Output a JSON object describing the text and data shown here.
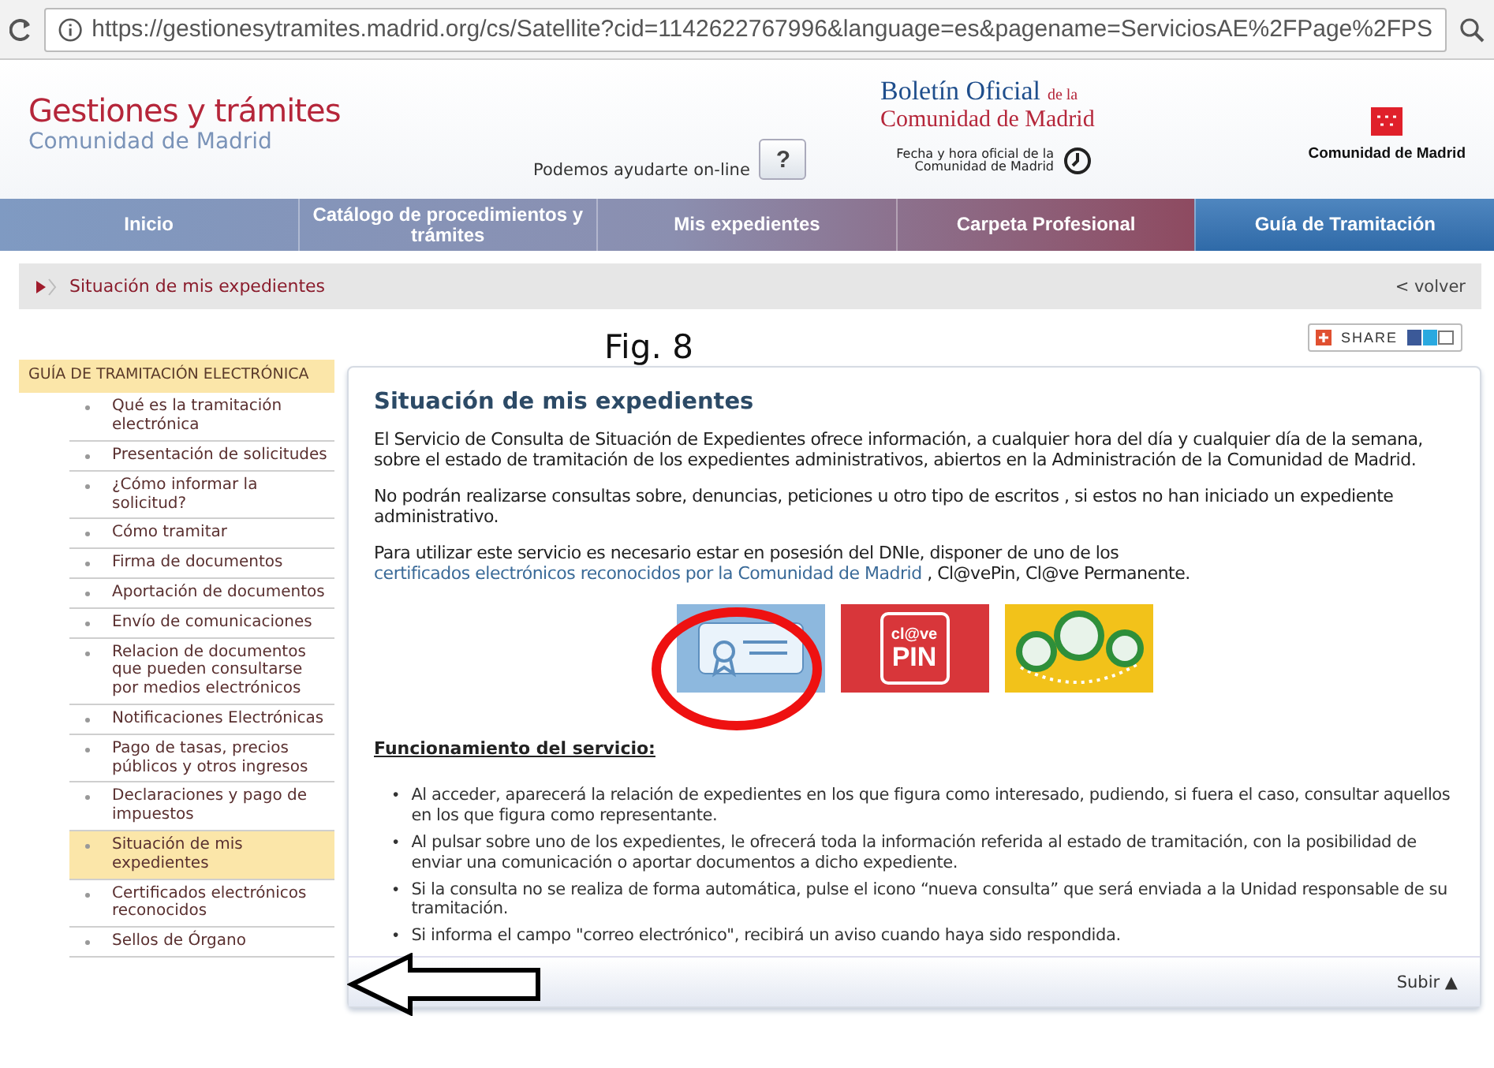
{
  "browser": {
    "url": "https://gestionesytramites.madrid.org/cs/Satellite?cid=1142622767996&language=es&pagename=ServiciosAE%2FPage%2FPS"
  },
  "header": {
    "site_title": "Gestiones y trámites",
    "site_subtitle": "Comunidad de Madrid",
    "help_text": "Podemos ayudarte on-line",
    "help_button": "?",
    "bulletin_title": "Boletín Oficial",
    "bulletin_de_la": "de la",
    "bulletin_subtitle": "Comunidad de Madrid",
    "official_time": "Fecha y hora oficial de la Comunidad de Madrid",
    "region_logo": "Comunidad de Madrid"
  },
  "nav": [
    {
      "label": "Inicio",
      "selected": false
    },
    {
      "label": "Catálogo de procedimientos y trámites",
      "selected": false
    },
    {
      "label": "Mis expedientes",
      "selected": false
    },
    {
      "label": "Carpeta Profesional",
      "selected": false
    },
    {
      "label": "Guía de Tramitación",
      "selected": true
    }
  ],
  "breadcrumb": {
    "current": "Situación de mis expedientes",
    "back": "< volver"
  },
  "share": {
    "label": "SHARE"
  },
  "sidebar": {
    "title": "GUÍA DE TRAMITACIÓN ELECTRÓNICA",
    "items": [
      {
        "label": "Qué es la tramitación electrónica",
        "selected": false
      },
      {
        "label": "Presentación de solicitudes",
        "selected": false
      },
      {
        "label": "¿Cómo informar la solicitud?",
        "selected": false
      },
      {
        "label": "Cómo tramitar",
        "selected": false
      },
      {
        "label": "Firma de documentos",
        "selected": false
      },
      {
        "label": "Aportación de documentos",
        "selected": false
      },
      {
        "label": "Envío de comunicaciones",
        "selected": false
      },
      {
        "label": "Relacion de documentos que pueden consultarse por medios electrónicos",
        "selected": false
      },
      {
        "label": "Notificaciones Electrónicas",
        "selected": false
      },
      {
        "label": "Pago de tasas, precios públicos y otros ingresos",
        "selected": false
      },
      {
        "label": "Declaraciones y pago de impuestos",
        "selected": false
      },
      {
        "label": "Situación de mis expedientes",
        "selected": true
      },
      {
        "label": "Certificados electrónicos reconocidos",
        "selected": false
      },
      {
        "label": "Sellos de Órgano",
        "selected": false
      }
    ]
  },
  "content": {
    "title": "Situación de mis expedientes",
    "paragraphs": [
      [
        {
          "kind": "text",
          "text": "El Servicio de Consulta de Situación de Expedientes ofrece información, a cualquier hora del día y cualquier día de la semana, sobre el estado de tramitación de los expedientes administrativos, abiertos en la Administración de la Comunidad de Madrid."
        }
      ],
      [
        {
          "kind": "text",
          "text": "No podrán realizarse consultas sobre, denuncias, peticiones u otro tipo de escritos , si estos no han iniciado un expediente administrativo."
        }
      ],
      [
        {
          "kind": "text",
          "text": "Para utilizar este servicio es necesario estar en posesión del DNIe, disponer de uno de los"
        },
        {
          "kind": "link",
          "text": "certificados electrónicos reconocidos por"
        },
        {
          "kind": "link",
          "text": "la Comunidad de Madrid"
        },
        {
          "kind": "text",
          "text": ", Cl@vePin, Cl@ve Permanente."
        }
      ]
    ],
    "access_icons": [
      {
        "kind": "certificate"
      },
      {
        "kind": "pin",
        "top": "cl@ve",
        "bottom": "PIN"
      },
      {
        "kind": "permanent"
      }
    ],
    "section_title": "Funcionamiento del servicio:",
    "bullet_marker": "•",
    "bullets": [
      "Al acceder, aparecerá la relación de expedientes en los que figura como interesado, pudiendo, si fuera el caso,  consultar aquellos en los que figura como representante.",
      "Al pulsar sobre uno de los expedientes, le ofrecerá toda la información referida al estado de tramitación, con la posibilidad de enviar una comunicación o aportar documentos a dicho expediente.",
      "Si la consulta no se realiza de forma automática, pulse el icono “nueva consulta” que será enviada a la Unidad responsable de su tramitación.",
      "Si informa el campo \"correo electrónico\", recibirá un aviso cuando haya sido respondida."
    ],
    "top_link": "Subir ▲"
  },
  "annotations": {
    "figure_label": "Fig. 8"
  }
}
